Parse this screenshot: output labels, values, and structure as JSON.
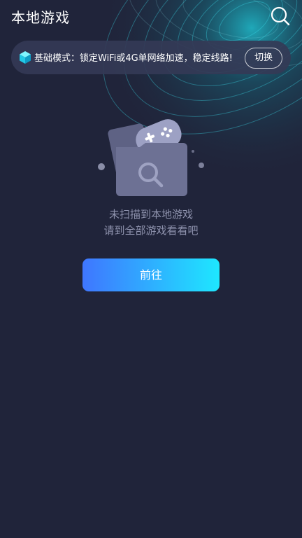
{
  "header": {
    "title": "本地游戏",
    "search_icon": "search-icon"
  },
  "notice": {
    "icon": "cube-icon",
    "text": "基础模式：锁定WiFi或4G单网络加速，稳定线路!",
    "switch_label": "切换"
  },
  "empty_state": {
    "illustration": "folder-gamepad-illustration",
    "line1": "未扫描到本地游戏",
    "line2": "请到全部游戏看看吧"
  },
  "go_button": {
    "label": "前往"
  },
  "colors": {
    "background": "#20243a",
    "button_gradient_start": "#3f76ff",
    "button_gradient_end": "#1ee7ff",
    "muted_text": "#8e92ad",
    "swirl": "#16c6d8"
  }
}
